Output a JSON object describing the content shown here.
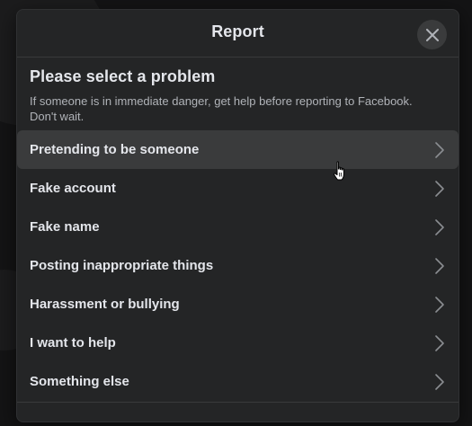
{
  "dialog": {
    "title": "Report"
  },
  "section": {
    "title": "Please select a problem",
    "description": "If someone is in immediate danger, get help before reporting to Facebook. Don't wait."
  },
  "options": [
    {
      "label": "Pretending to be someone",
      "hovered": true
    },
    {
      "label": "Fake account",
      "hovered": false
    },
    {
      "label": "Fake name",
      "hovered": false
    },
    {
      "label": "Posting inappropriate things",
      "hovered": false
    },
    {
      "label": "Harassment or bullying",
      "hovered": false
    },
    {
      "label": "I want to help",
      "hovered": false
    },
    {
      "label": "Something else",
      "hovered": false
    }
  ],
  "icons": {
    "close": "close-icon",
    "chevron": "chevron-right-icon",
    "cursor": "hand-pointer-icon"
  },
  "colors": {
    "modal_bg": "#242526",
    "hover_bg": "#3a3b3c",
    "text_primary": "#e4e6eb",
    "text_secondary": "#b0b3b8"
  }
}
